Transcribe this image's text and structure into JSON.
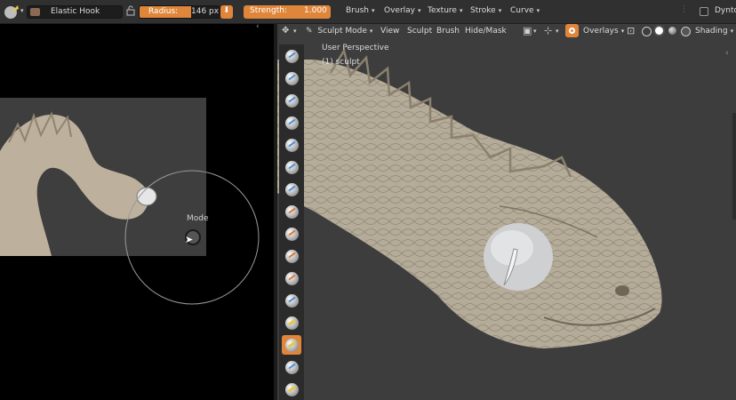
{
  "topbar": {
    "brush_name": "Elastic Hook",
    "radius_label": "Radius:",
    "radius_value": "146 px",
    "strength_label": "Strength:",
    "strength_value": "1.000",
    "menus": [
      "Brush",
      "Overlay",
      "Texture",
      "Stroke",
      "Curve"
    ],
    "dyntopo_label": "Dynto"
  },
  "viewport": {
    "mode_label": "Sculpt Mode",
    "menus": [
      "View",
      "Sculpt",
      "Brush",
      "Hide/Mask"
    ],
    "overlays_label": "Overlays",
    "shading_label": "Shading",
    "perspective_text": "User Perspective",
    "object_text": "(1) sculpt"
  },
  "reference": {
    "cursor_label": "Mode"
  },
  "colors": {
    "accent": "#e0863a",
    "panel": "#303030",
    "viewport_bg": "#3d3d3d",
    "clay": "#b5ab99"
  }
}
